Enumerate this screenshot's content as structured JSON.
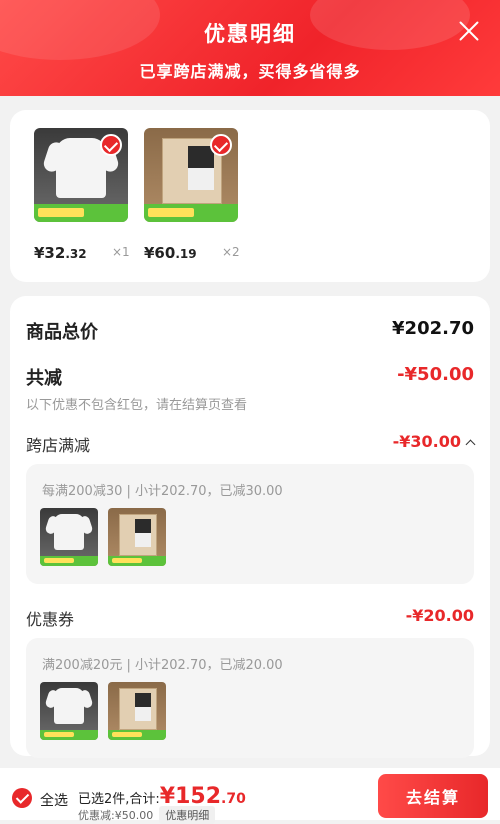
{
  "header": {
    "title": "优惠明细",
    "subtitle": "已享跨店满减，买得多省得多"
  },
  "products": [
    {
      "price_int": "¥32",
      "price_dec": ".32",
      "qty": "×1",
      "image": "white-tshirt"
    },
    {
      "price_int": "¥60",
      "price_dec": ".19",
      "qty": "×2",
      "image": "boxed-tshirt"
    }
  ],
  "summary": {
    "total_label": "商品总价",
    "total_value": "¥202.70",
    "reduce_label": "共减",
    "reduce_value": "-¥50.00",
    "note": "以下优惠不包含红包，请在结算页查看"
  },
  "cross_store": {
    "label": "跨店满减",
    "value": "-¥30.00",
    "desc": "每满200减30 | 小计202.70，已减30.00"
  },
  "coupon": {
    "label": "优惠券",
    "value": "-¥20.00",
    "desc": "满200减20元 | 小计202.70，已减20.00"
  },
  "bottom": {
    "select_all": "全选",
    "selected_text": "已选2件,合计:",
    "amount_int": "¥152",
    "amount_dec": ".70",
    "discount_text": "优惠减:¥50.00",
    "detail_label": "优惠明细",
    "checkout_label": "去结算"
  },
  "colors": {
    "accent": "#e8282a",
    "header_gradient_start": "#ff4a48",
    "promo_green": "#5cc23b"
  }
}
